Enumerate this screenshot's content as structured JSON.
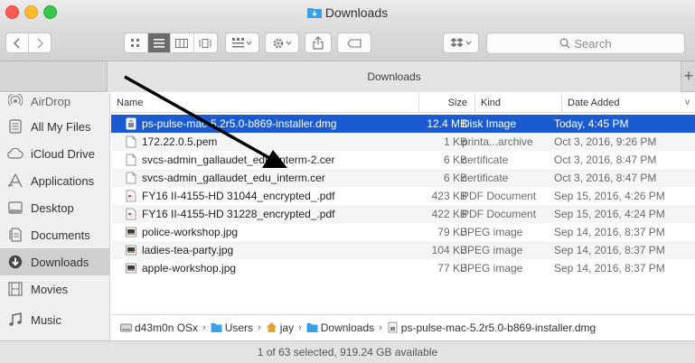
{
  "window": {
    "title": "Downloads",
    "accent": "#1b5bd1"
  },
  "toolbar": {
    "search_placeholder": "Search",
    "back_icon": "chevron-left-icon",
    "forward_icon": "chevron-right-icon",
    "view_modes": [
      "icon-view",
      "list-view",
      "column-view",
      "cover-flow-view"
    ],
    "active_view": "list-view"
  },
  "tab": {
    "title": "Downloads",
    "add_label": "+"
  },
  "sidebar": {
    "items": [
      {
        "label": "AirDrop",
        "icon": "airdrop-icon"
      },
      {
        "label": "All My Files",
        "icon": "all-files-icon"
      },
      {
        "label": "iCloud Drive",
        "icon": "cloud-icon"
      },
      {
        "label": "Applications",
        "icon": "applications-icon"
      },
      {
        "label": "Desktop",
        "icon": "desktop-icon"
      },
      {
        "label": "Documents",
        "icon": "documents-icon"
      },
      {
        "label": "Downloads",
        "icon": "downloads-icon"
      },
      {
        "label": "Movies",
        "icon": "movies-icon"
      },
      {
        "label": "Music",
        "icon": "music-icon"
      }
    ],
    "selected": "Downloads"
  },
  "columns": {
    "name": "Name",
    "size": "Size",
    "kind": "Kind",
    "date": "Date Added",
    "sort_indicator": "v"
  },
  "files": [
    {
      "name": "ps-pulse-mac-5.2r5.0-b869-installer.dmg",
      "size": "12.4 MB",
      "kind": "Disk Image",
      "date": "Today, 4:45 PM",
      "icon": "disk-image-icon",
      "selected": true
    },
    {
      "name": "172.22.0.5.pem",
      "size": "1 KB",
      "kind": "printa...archive",
      "date": "Oct 3, 2016, 9:26 PM",
      "icon": "document-icon"
    },
    {
      "name": "svcs-admin_gallaudet_edu_interm-2.cer",
      "size": "6 KB",
      "kind": "certificate",
      "date": "Oct 3, 2016, 8:47 PM",
      "icon": "document-icon"
    },
    {
      "name": "svcs-admin_gallaudet_edu_interm.cer",
      "size": "6 KB",
      "kind": "certificate",
      "date": "Oct 3, 2016, 8:47 PM",
      "icon": "document-icon"
    },
    {
      "name": "FY16 II-4155-HD 31044_encrypted_.pdf",
      "size": "423 KB",
      "kind": "PDF Document",
      "date": "Sep 15, 2016, 4:26 PM",
      "icon": "pdf-icon"
    },
    {
      "name": "FY16 II-4155-HD 31228_encrypted_.pdf",
      "size": "422 KB",
      "kind": "PDF Document",
      "date": "Sep 15, 2016, 4:24 PM",
      "icon": "pdf-icon"
    },
    {
      "name": "police-workshop.jpg",
      "size": "79 KB",
      "kind": "JPEG image",
      "date": "Sep 14, 2016, 8:37 PM",
      "icon": "image-icon"
    },
    {
      "name": "ladies-tea-party.jpg",
      "size": "104 KB",
      "kind": "JPEG image",
      "date": "Sep 14, 2016, 8:37 PM",
      "icon": "image-icon"
    },
    {
      "name": "apple-workshop.jpg",
      "size": "77 KB",
      "kind": "JPEG image",
      "date": "Sep 14, 2016, 8:37 PM",
      "icon": "image-icon"
    }
  ],
  "pathbar": {
    "segments": [
      {
        "label": "d43m0n OSx",
        "icon": "hard-drive-icon"
      },
      {
        "label": "Users",
        "icon": "folder-icon"
      },
      {
        "label": "jay",
        "icon": "home-icon"
      },
      {
        "label": "Downloads",
        "icon": "folder-icon"
      },
      {
        "label": "ps-pulse-mac-5.2r5.0-b869-installer.dmg",
        "icon": "disk-image-icon"
      }
    ],
    "separator": "›"
  },
  "status": {
    "text": "1 of 63 selected, 919.24 GB available"
  }
}
